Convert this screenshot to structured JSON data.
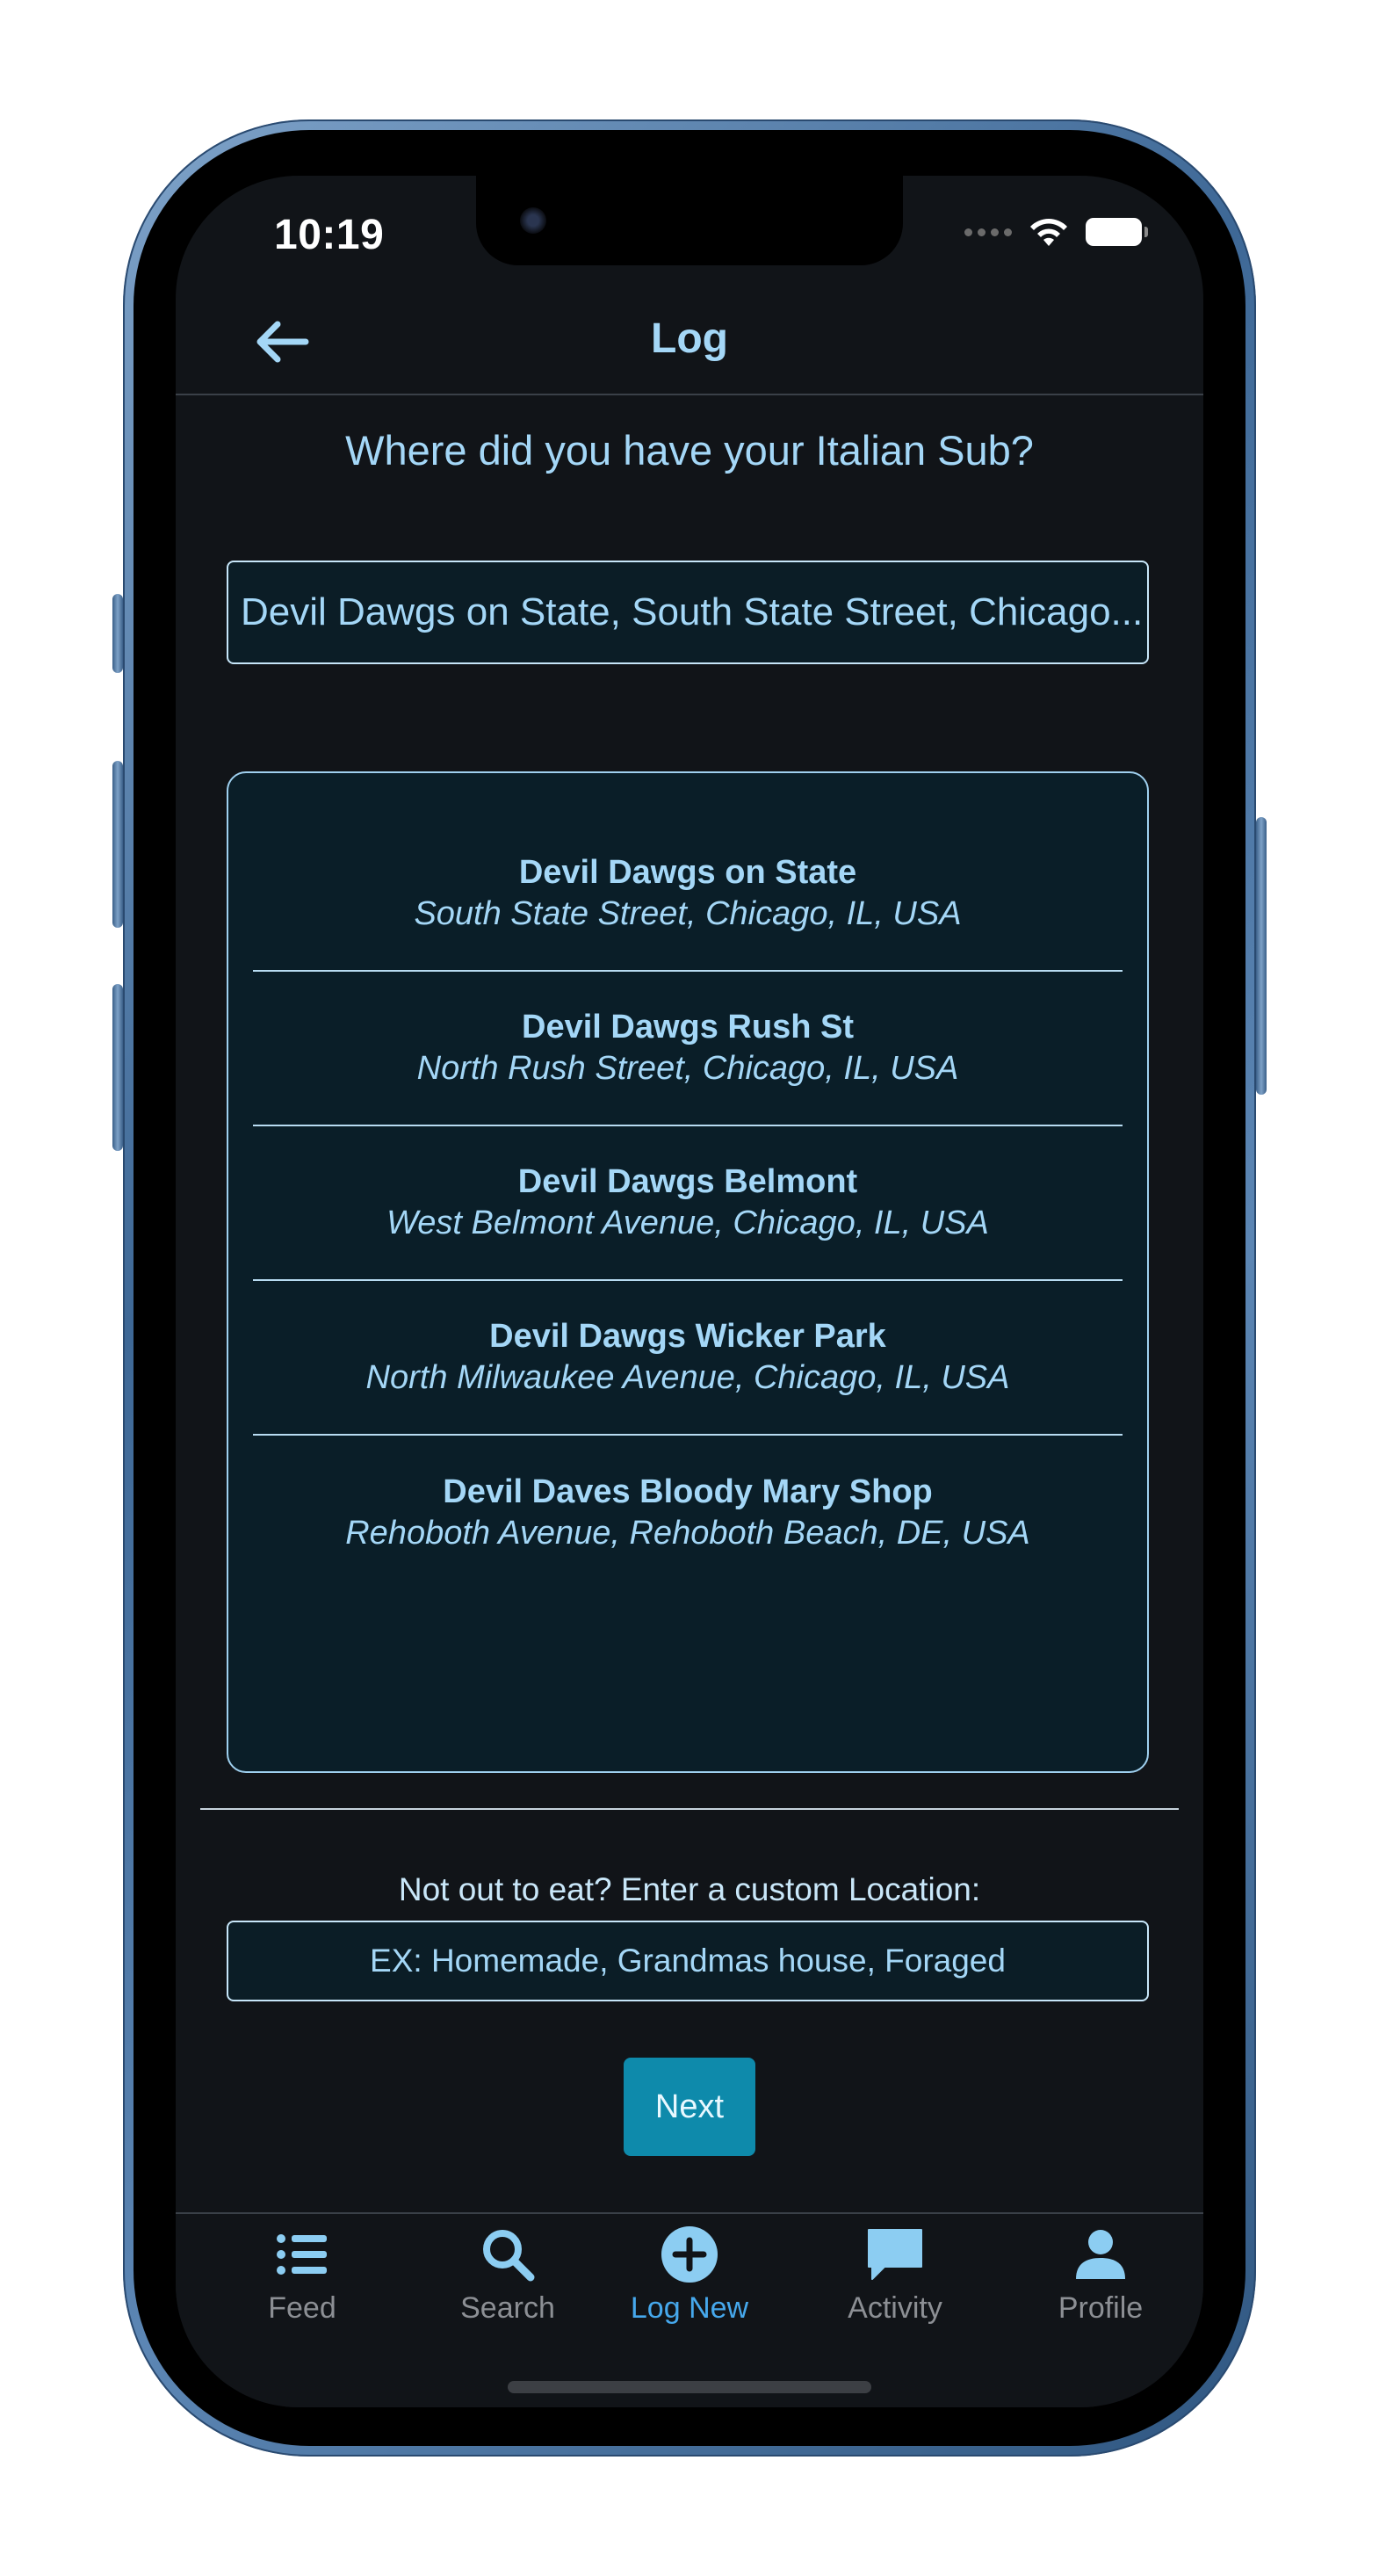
{
  "status_bar": {
    "time": "10:19"
  },
  "header": {
    "title": "Log",
    "back_icon": "arrow-left-icon"
  },
  "question": "Where did you have your Italian Sub?",
  "search": {
    "value": "Devil Dawgs on State, South State Street, Chicago..."
  },
  "results": [
    {
      "name": "Devil Dawgs on State",
      "address": "South State Street, Chicago, IL, USA"
    },
    {
      "name": "Devil Dawgs Rush St",
      "address": "North Rush Street, Chicago, IL, USA"
    },
    {
      "name": "Devil Dawgs Belmont",
      "address": "West Belmont Avenue, Chicago, IL, USA"
    },
    {
      "name": "Devil Dawgs Wicker Park",
      "address": "North Milwaukee Avenue, Chicago, IL, USA"
    },
    {
      "name": "Devil Daves Bloody Mary Shop",
      "address": "Rehoboth Avenue, Rehoboth Beach, DE, USA"
    }
  ],
  "custom": {
    "label": "Not out to eat? Enter a custom Location:",
    "placeholder": "EX: Homemade, Grandmas house, Foraged"
  },
  "next_label": "Next",
  "tabs": [
    {
      "label": "Feed",
      "icon": "list-icon",
      "active": false
    },
    {
      "label": "Search",
      "icon": "search-icon",
      "active": false
    },
    {
      "label": "Log New",
      "icon": "plus-circle-icon",
      "active": true
    },
    {
      "label": "Activity",
      "icon": "chat-bubble-icon",
      "active": false
    },
    {
      "label": "Profile",
      "icon": "person-icon",
      "active": false
    }
  ],
  "colors": {
    "accent": "#A4D7F7",
    "active_tab": "#46A8EC",
    "button": "#0E8AAB",
    "background": "#111418",
    "frame": "#3E6896"
  }
}
